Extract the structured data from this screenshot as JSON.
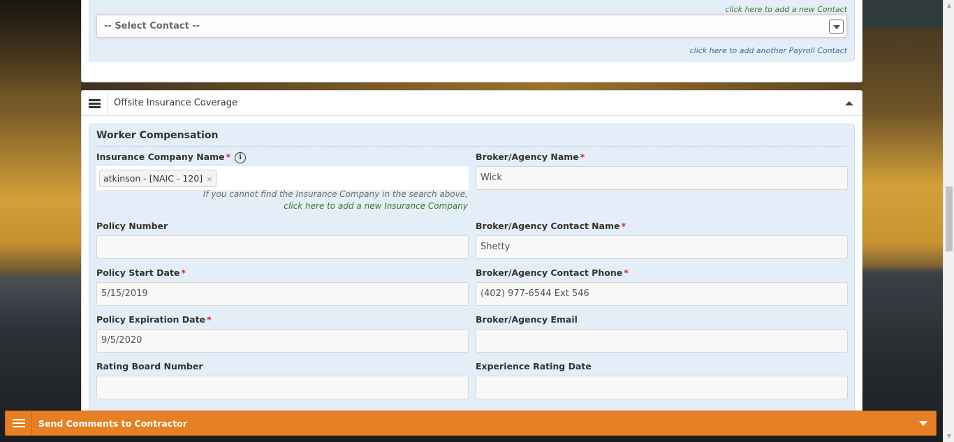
{
  "contact_section": {
    "add_contact_link": "click here to add a new Contact",
    "select_placeholder": "-- Select Contact --",
    "add_payroll_link": "click here to add another Payroll Contact"
  },
  "coverage_section": {
    "title": "Offsite Insurance Coverage",
    "worker_comp": {
      "title": "Worker Compensation",
      "insurance_company_label": "Insurance Company Name",
      "insurance_company_tag": "atkinson - [NAIC - 120]",
      "insurance_company_hint": "If you cannot find the Insurance Company in the search above,",
      "insurance_company_link": "click here to add a new Insurance Company",
      "broker_name_label": "Broker/Agency Name",
      "broker_name_value": "Wick",
      "policy_number_label": "Policy Number",
      "policy_number_value": "",
      "broker_contact_label": "Broker/Agency Contact Name",
      "broker_contact_value": "Shetty",
      "policy_start_label": "Policy Start Date",
      "policy_start_value": "5/15/2019",
      "broker_phone_label": "Broker/Agency Contact Phone",
      "broker_phone_value": "(402) 977-6544 Ext 546",
      "policy_exp_label": "Policy Expiration Date",
      "policy_exp_value": "9/5/2020",
      "broker_email_label": "Broker/Agency Email",
      "broker_email_value": "",
      "rating_board_label": "Rating Board Number",
      "rating_board_value": "",
      "exp_rating_label": "Experience Rating Date",
      "exp_rating_value": ""
    }
  },
  "bottom_bar": {
    "label": "Send Comments to Contractor",
    "color": "#e78024"
  },
  "required_marker": "*",
  "info_glyph": "i",
  "tag_remove_glyph": "×",
  "icons": [
    "hamburger-icon",
    "caret-up-icon",
    "caret-down-icon",
    "info-icon",
    "dropdown-arrow-icon"
  ]
}
